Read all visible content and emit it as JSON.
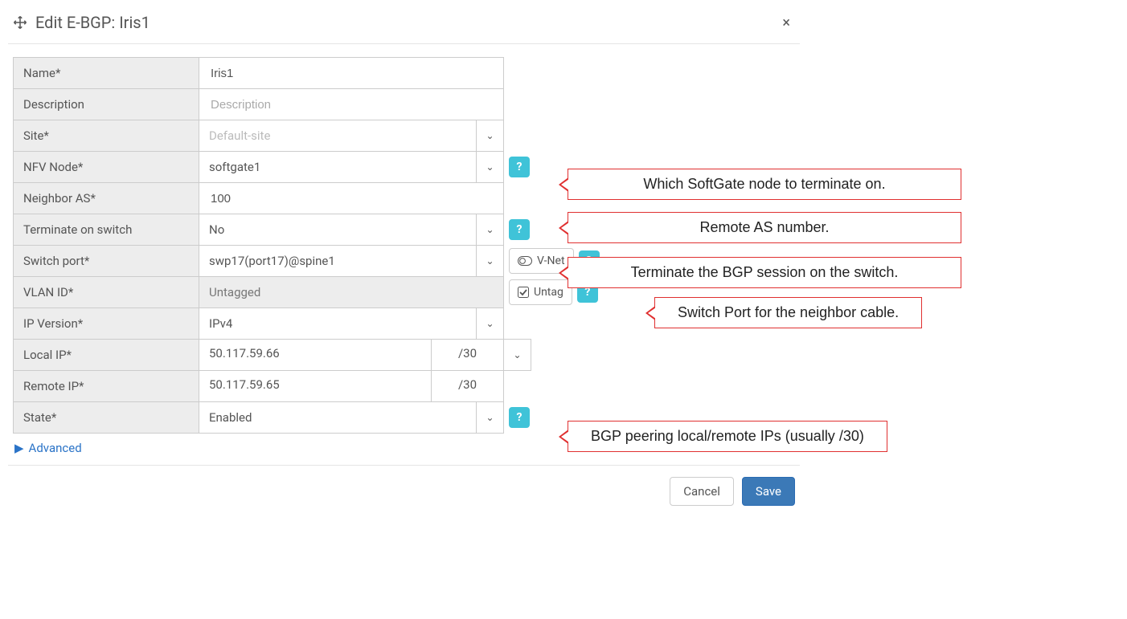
{
  "header": {
    "title": "Edit E-BGP: Iris1"
  },
  "fields": {
    "name": {
      "label": "Name*",
      "value": "Iris1"
    },
    "description": {
      "label": "Description",
      "value": "",
      "placeholder": "Description"
    },
    "site": {
      "label": "Site*",
      "value": "Default-site"
    },
    "nfv_node": {
      "label": "NFV Node*",
      "value": "softgate1"
    },
    "neighbor_as": {
      "label": "Neighbor AS*",
      "value": "100"
    },
    "terminate_on_switch": {
      "label": "Terminate on switch",
      "value": "No"
    },
    "switch_port": {
      "label": "Switch port*",
      "value": "swp17(port17)@spine1",
      "side_button": "V-Net"
    },
    "vlan_id": {
      "label": "VLAN ID*",
      "value": "Untagged",
      "side_button": "Untag"
    },
    "ip_version": {
      "label": "IP Version*",
      "value": "IPv4"
    },
    "local_ip": {
      "label": "Local IP*",
      "value": "50.117.59.66",
      "mask": "/30"
    },
    "remote_ip": {
      "label": "Remote IP*",
      "value": "50.117.59.65",
      "mask": "/30"
    },
    "state": {
      "label": "State*",
      "value": "Enabled"
    }
  },
  "advanced_label": "Advanced",
  "buttons": {
    "cancel": "Cancel",
    "save": "Save"
  },
  "callouts": {
    "nfv": "Which SoftGate node to terminate on.",
    "as": "Remote AS number.",
    "tos": "Terminate the BGP session on the switch.",
    "port": "Switch Port for the neighbor cable.",
    "ips": "BGP peering local/remote IPs (usually /30)"
  }
}
